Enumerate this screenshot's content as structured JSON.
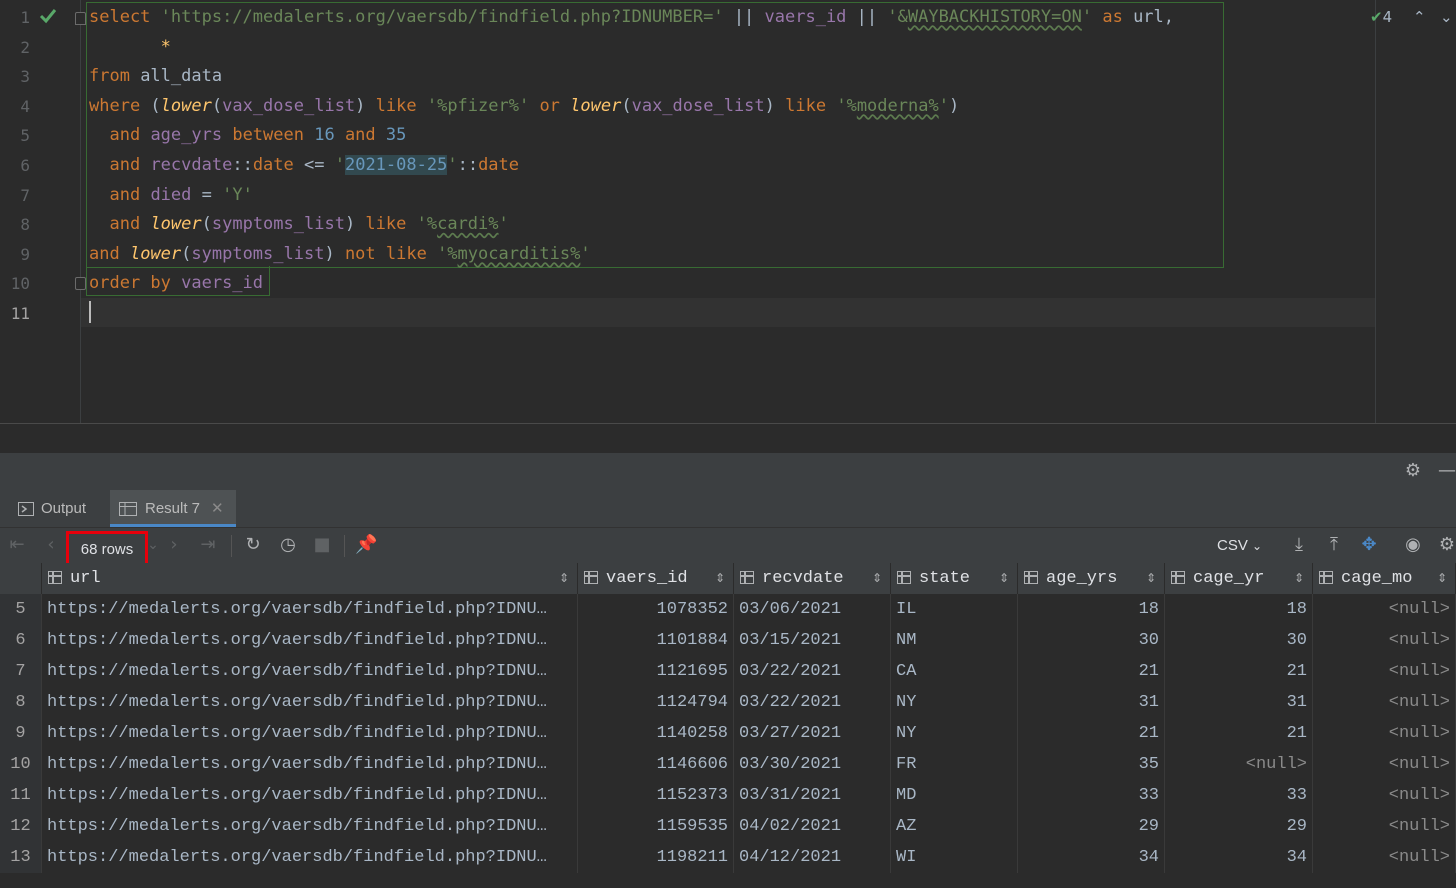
{
  "editor": {
    "line_numbers": [
      "1",
      "2",
      "3",
      "4",
      "5",
      "6",
      "7",
      "8",
      "9",
      "10",
      "11"
    ],
    "inspections_count": "4",
    "lines": [
      [
        [
          "kw",
          "select "
        ],
        [
          "str",
          "'https://medalerts.org/vaersdb/findfield.php?IDNUMBER='"
        ],
        [
          "pl",
          " || "
        ],
        [
          "id",
          "vaers_id"
        ],
        [
          "pl",
          " || "
        ],
        [
          "str",
          "'&WAYBACKHISTORY=ON'"
        ],
        [
          "kw",
          " as "
        ],
        [
          "pl",
          "url,"
        ]
      ],
      [
        [
          "pl",
          "       "
        ],
        [
          "fn",
          "*"
        ]
      ],
      [
        [
          "kw",
          "from "
        ],
        [
          "pl",
          "all_data"
        ]
      ],
      [
        [
          "kw",
          "where "
        ],
        [
          "pl",
          "("
        ],
        [
          "fn",
          "lower"
        ],
        [
          "pl",
          "("
        ],
        [
          "id",
          "vax_dose_list"
        ],
        [
          "pl",
          ") "
        ],
        [
          "kw",
          "like "
        ],
        [
          "str",
          "'%pfizer%'"
        ],
        [
          "kw",
          " or "
        ],
        [
          "fn",
          "lower"
        ],
        [
          "pl",
          "("
        ],
        [
          "id",
          "vax_dose_list"
        ],
        [
          "pl",
          ") "
        ],
        [
          "kw",
          "like "
        ],
        [
          "str",
          "'%moderna%'"
        ],
        [
          "pl",
          ")"
        ]
      ],
      [
        [
          "pl",
          "  "
        ],
        [
          "kw",
          "and "
        ],
        [
          "id",
          "age_yrs"
        ],
        [
          "kw",
          " between "
        ],
        [
          "num",
          "16"
        ],
        [
          "kw",
          " and "
        ],
        [
          "num",
          "35"
        ]
      ],
      [
        [
          "pl",
          "  "
        ],
        [
          "kw",
          "and "
        ],
        [
          "id",
          "recvdate"
        ],
        [
          "pl",
          "::"
        ],
        [
          "kw",
          "date"
        ],
        [
          "pl",
          " <= "
        ],
        [
          "str",
          "'"
        ],
        [
          "hl",
          "2021-08-25"
        ],
        [
          "str",
          "'"
        ],
        [
          "pl",
          "::"
        ],
        [
          "kw",
          "date"
        ]
      ],
      [
        [
          "pl",
          "  "
        ],
        [
          "kw",
          "and "
        ],
        [
          "id",
          "died"
        ],
        [
          "pl",
          " = "
        ],
        [
          "str",
          "'Y'"
        ]
      ],
      [
        [
          "pl",
          "  "
        ],
        [
          "kw",
          "and "
        ],
        [
          "fn",
          "lower"
        ],
        [
          "pl",
          "("
        ],
        [
          "id",
          "symptoms_list"
        ],
        [
          "pl",
          ") "
        ],
        [
          "kw",
          "like "
        ],
        [
          "str",
          "'%cardi%'"
        ]
      ],
      [
        [
          "kw",
          "and "
        ],
        [
          "fn",
          "lower"
        ],
        [
          "pl",
          "("
        ],
        [
          "id",
          "symptoms_list"
        ],
        [
          "pl",
          ") "
        ],
        [
          "kw",
          "not like "
        ],
        [
          "str",
          "'%myocarditis%'"
        ]
      ],
      [
        [
          "kw",
          "order by "
        ],
        [
          "id",
          "vaers_id"
        ]
      ],
      []
    ]
  },
  "tabs": {
    "output": "Output",
    "result": "Result 7"
  },
  "toolbar": {
    "rows": "68 rows",
    "format": "CSV"
  },
  "grid": {
    "columns": [
      "url",
      "vaers_id",
      "recvdate",
      "state",
      "age_yrs",
      "cage_yr",
      "cage_mo"
    ],
    "rows": [
      [
        "5",
        "https://medalerts.org/vaersdb/findfield.php?IDNU…",
        "1078352",
        "03/06/2021",
        "IL",
        "18",
        "18",
        "<null>"
      ],
      [
        "6",
        "https://medalerts.org/vaersdb/findfield.php?IDNU…",
        "1101884",
        "03/15/2021",
        "NM",
        "30",
        "30",
        "<null>"
      ],
      [
        "7",
        "https://medalerts.org/vaersdb/findfield.php?IDNU…",
        "1121695",
        "03/22/2021",
        "CA",
        "21",
        "21",
        "<null>"
      ],
      [
        "8",
        "https://medalerts.org/vaersdb/findfield.php?IDNU…",
        "1124794",
        "03/22/2021",
        "NY",
        "31",
        "31",
        "<null>"
      ],
      [
        "9",
        "https://medalerts.org/vaersdb/findfield.php?IDNU…",
        "1140258",
        "03/27/2021",
        "NY",
        "21",
        "21",
        "<null>"
      ],
      [
        "10",
        "https://medalerts.org/vaersdb/findfield.php?IDNU…",
        "1146606",
        "03/30/2021",
        "FR",
        "35",
        "<null>",
        "<null>"
      ],
      [
        "11",
        "https://medalerts.org/vaersdb/findfield.php?IDNU…",
        "1152373",
        "03/31/2021",
        "MD",
        "33",
        "33",
        "<null>"
      ],
      [
        "12",
        "https://medalerts.org/vaersdb/findfield.php?IDNU…",
        "1159535",
        "04/02/2021",
        "AZ",
        "29",
        "29",
        "<null>"
      ],
      [
        "13",
        "https://medalerts.org/vaersdb/findfield.php?IDNU…",
        "1198211",
        "04/12/2021",
        "WI",
        "34",
        "34",
        "<null>"
      ]
    ]
  }
}
